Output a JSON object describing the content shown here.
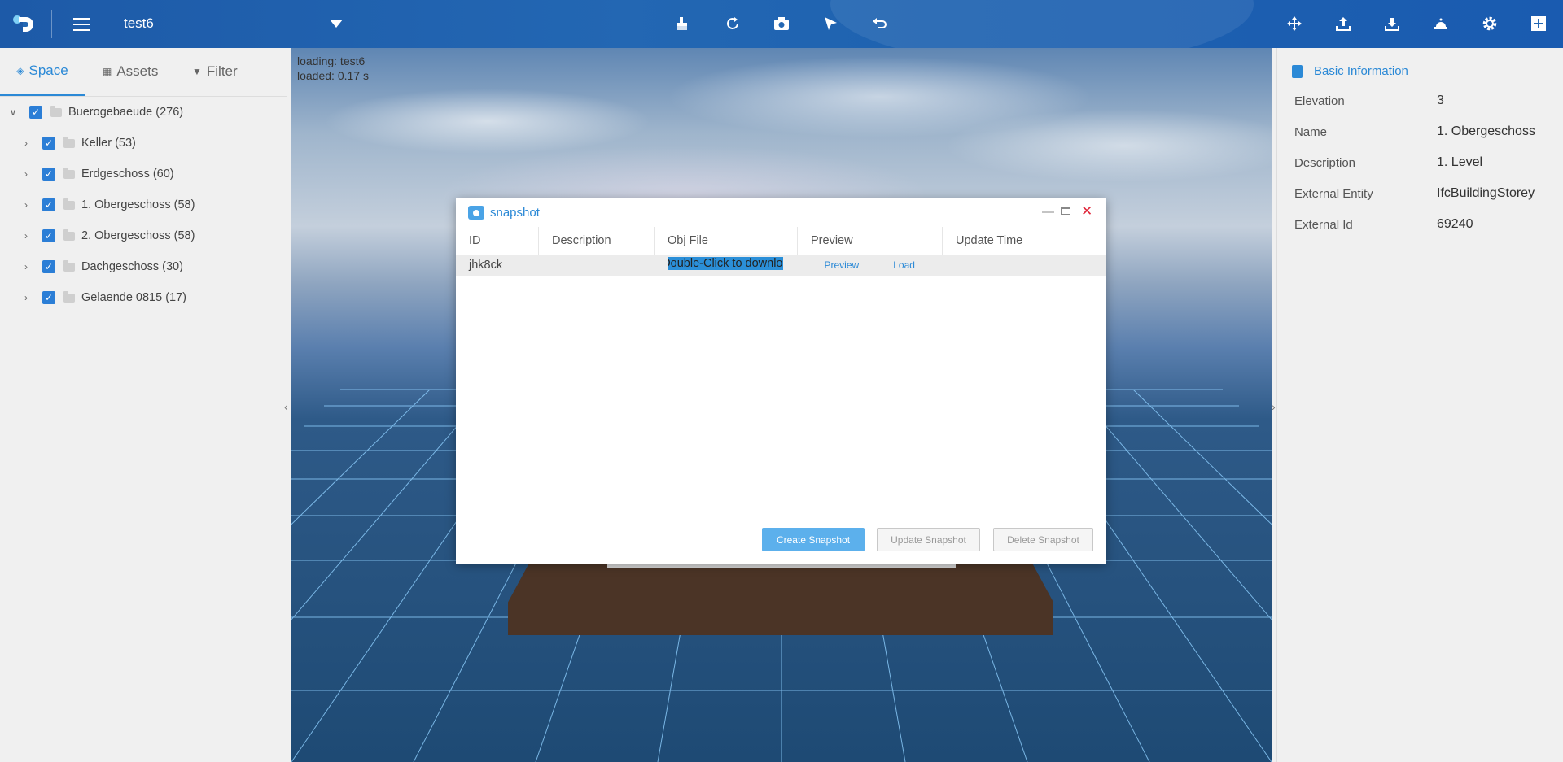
{
  "topbar": {
    "project_name": "test6",
    "left_icons": [
      "logo",
      "menu-icon",
      "dropdown-caret-icon"
    ],
    "center_icons": [
      "brush-icon",
      "rotate-icon",
      "camera-icon",
      "cursor-icon",
      "undo-icon"
    ],
    "right_icons": [
      "move-icon",
      "upload-icon",
      "download-icon",
      "bell-icon",
      "gear-icon",
      "add-panel-icon"
    ]
  },
  "left_panel": {
    "tabs": [
      {
        "label": "Space",
        "icon": "cube-icon",
        "active": true
      },
      {
        "label": "Assets",
        "icon": "box-icon",
        "active": false
      },
      {
        "label": "Filter",
        "icon": "filter-icon",
        "active": false
      }
    ],
    "tree": {
      "root": {
        "label": "Buerogebaeude (276)",
        "checked": true,
        "expanded": true
      },
      "children": [
        {
          "label": "Keller (53)",
          "checked": true
        },
        {
          "label": "Erdgeschoss (60)",
          "checked": true
        },
        {
          "label": "1. Obergeschoss (58)",
          "checked": true
        },
        {
          "label": "2. Obergeschoss (58)",
          "checked": true
        },
        {
          "label": "Dachgeschoss (30)",
          "checked": true
        },
        {
          "label": "Gelaende 0815 (17)",
          "checked": true
        }
      ]
    }
  },
  "viewport": {
    "loading_text": "loading: test6",
    "loaded_text": "loaded: 0.17 s"
  },
  "right_panel": {
    "title": "Basic Information",
    "properties": [
      {
        "key": "Elevation",
        "value": "3"
      },
      {
        "key": "Name",
        "value": "1. Obergeschoss"
      },
      {
        "key": "Description",
        "value": "1. Level"
      },
      {
        "key": "External Entity",
        "value": "IfcBuildingStorey"
      },
      {
        "key": "External Id",
        "value": "69240"
      }
    ]
  },
  "dialog": {
    "title": "snapshot",
    "columns": [
      "ID",
      "Description",
      "Obj File",
      "Preview",
      "Update Time"
    ],
    "rows": [
      {
        "id": "jhk8ck",
        "description": "",
        "obj_file": "Double-Click to downlo",
        "preview_link": "Preview",
        "load_link": "Load",
        "update_time": ""
      }
    ],
    "buttons": {
      "create": "Create Snapshot",
      "update": "Update Snapshot",
      "delete": "Delete Snapshot"
    }
  },
  "colors": {
    "topbar": "#2367b3",
    "accent": "#2b89d6",
    "checkbox": "#2b7ed6",
    "primary_button": "#5cb0ec"
  }
}
